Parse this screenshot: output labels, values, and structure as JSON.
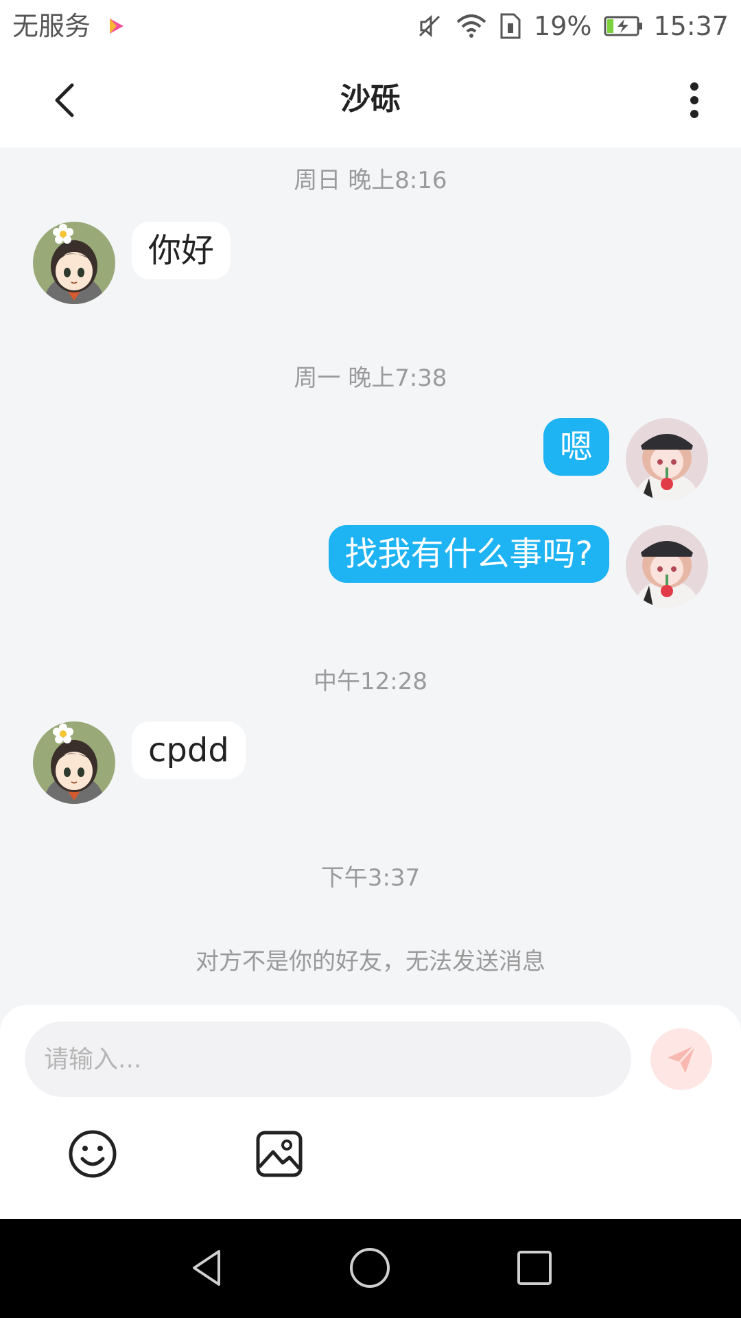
{
  "status_bar": {
    "carrier": "无服务",
    "battery_percent": "19%",
    "time": "15:37",
    "icons": [
      "video-app-icon",
      "mute-icon",
      "wifi-icon",
      "sim-icon",
      "battery-charging-icon"
    ]
  },
  "header": {
    "title": "沙砾",
    "back_icon": "chevron-left-icon",
    "more_icon": "more-vertical-icon"
  },
  "messages": [
    {
      "type": "timestamp",
      "text": "周日 晚上8:16"
    },
    {
      "type": "incoming",
      "text": "你好"
    },
    {
      "type": "timestamp",
      "text": "周一 晚上7:38"
    },
    {
      "type": "outgoing",
      "text": "嗯"
    },
    {
      "type": "outgoing",
      "text": "找我有什么事吗?"
    },
    {
      "type": "timestamp",
      "text": "中午12:28"
    },
    {
      "type": "incoming",
      "text": "cpdd"
    },
    {
      "type": "timestamp",
      "text": "下午3:37"
    },
    {
      "type": "system",
      "text": "对方不是你的好友，无法发送消息"
    }
  ],
  "input": {
    "placeholder": "请输入...",
    "value": ""
  },
  "toolbar": {
    "icons": [
      "send-icon",
      "emoji-icon",
      "image-icon"
    ]
  },
  "colors": {
    "outgoing_bubble": "#1eb3f3",
    "incoming_bubble": "#ffffff",
    "chat_background": "#f4f5f7",
    "send_button": "#fde6e3"
  }
}
